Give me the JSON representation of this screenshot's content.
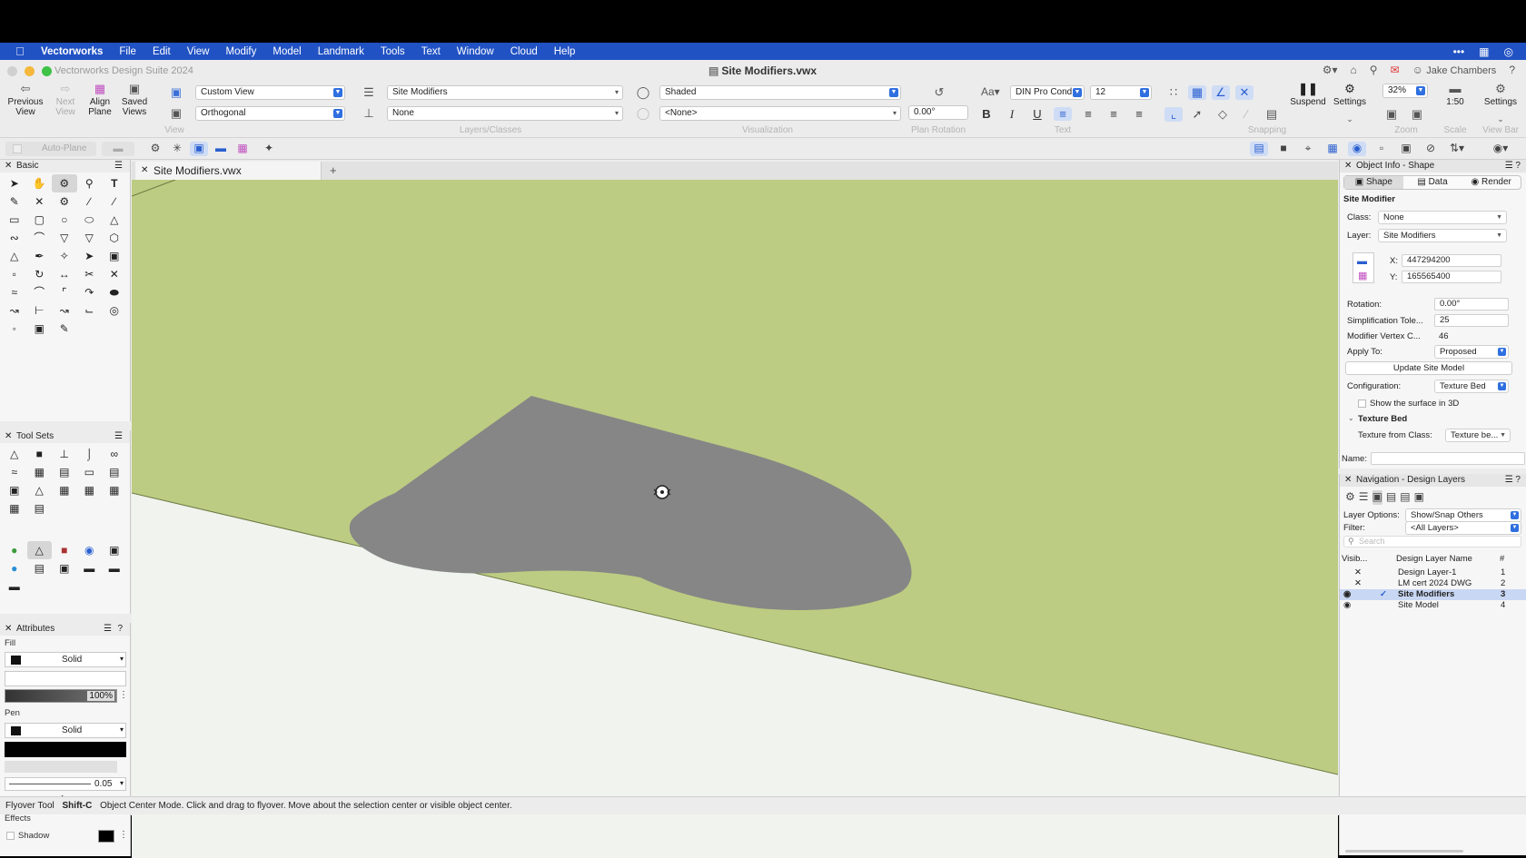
{
  "menubar": {
    "app": "Vectorworks",
    "items": [
      "File",
      "Edit",
      "View",
      "Modify",
      "Model",
      "Landmark",
      "Tools",
      "Text",
      "Window",
      "Cloud",
      "Help"
    ]
  },
  "window": {
    "app_title": "Vectorworks Design Suite 2024",
    "doc_title": "Site Modifiers.vwx",
    "user": "Jake Chambers"
  },
  "toolbar": {
    "previous_view": "Previous View",
    "next_view": "Next View",
    "align_plane": "Align Plane",
    "saved_views": "Saved Views",
    "view_select": "Custom View",
    "projection_select": "Orthogonal",
    "view_group": "View",
    "layer_select": "Site Modifiers",
    "class_select": "None",
    "layers_group": "Layers/Classes",
    "render_select": "Shaded",
    "style_select": "<None>",
    "visualization_group": "Visualization",
    "plan_rotation_value": "0.00°",
    "plan_rotation_group": "Plan Rotation",
    "font_select": "DIN Pro Cond",
    "font_size": "12",
    "text_group": "Text",
    "snapping_group": "Snapping",
    "suspend": "Suspend",
    "settings": "Settings",
    "zoom_value": "32%",
    "zoom_group": "Zoom",
    "scale_value": "1:50",
    "scale_group": "Scale",
    "viewbar_settings": "Settings",
    "viewbar_group": "View Bar",
    "auto_plane": "Auto-Plane"
  },
  "basic_palette": {
    "title": "Basic"
  },
  "toolsets_palette": {
    "title": "Tool Sets"
  },
  "attributes": {
    "title": "Attributes",
    "fill_label": "Fill",
    "fill_style": "Solid",
    "opacity": "100%",
    "pen_label": "Pen",
    "pen_style": "Solid",
    "line_weight": "0.05",
    "effects_label": "Effects",
    "shadow_label": "Shadow"
  },
  "doc_tab": {
    "label": "Site Modifiers.vwx"
  },
  "object_info": {
    "title": "Object Info - Shape",
    "tabs": [
      "Shape",
      "Data",
      "Render"
    ],
    "object_type": "Site Modifier",
    "class_label": "Class:",
    "class_value": "None",
    "layer_label": "Layer:",
    "layer_value": "Site Modifiers",
    "x_label": "X:",
    "x_value": "447294200",
    "y_label": "Y:",
    "y_value": "165565400",
    "rotation_label": "Rotation:",
    "rotation_value": "0.00°",
    "simplification_label": "Simplification Tole...",
    "simplification_value": "25",
    "vertex_label": "Modifier Vertex C...",
    "vertex_value": "46",
    "apply_label": "Apply To:",
    "apply_value": "Proposed",
    "update_button": "Update Site Model",
    "config_label": "Configuration:",
    "config_value": "Texture Bed",
    "show_surface": "Show the surface in 3D",
    "texture_bed_section": "Texture Bed",
    "texture_class_label": "Texture from Class:",
    "texture_class_value": "Texture be...",
    "name_label": "Name:"
  },
  "navigation": {
    "title": "Navigation - Design Layers",
    "layer_options_label": "Layer Options:",
    "layer_options_value": "Show/Snap Others",
    "filter_label": "Filter:",
    "filter_value": "<All Layers>",
    "search_placeholder": "Search",
    "col_visibility": "Visib...",
    "col_name": "Design Layer Name",
    "col_number": "#",
    "layers": [
      {
        "name": "Design Layer-1",
        "num": "1"
      },
      {
        "name": "LM cert 2024 DWG",
        "num": "2"
      },
      {
        "name": "Site Modifiers",
        "num": "3"
      },
      {
        "name": "Site Model",
        "num": "4"
      }
    ]
  },
  "status": {
    "tool": "Flyover Tool",
    "shortcut": "Shift-C",
    "message": "Object Center Mode. Click and drag to flyover.  Move about the selection center or visible object center."
  },
  "colors": {
    "menubar": "#2152c4",
    "terrain": "#bccc82",
    "modifier": "#868686",
    "selection": "#c8d7f3"
  }
}
